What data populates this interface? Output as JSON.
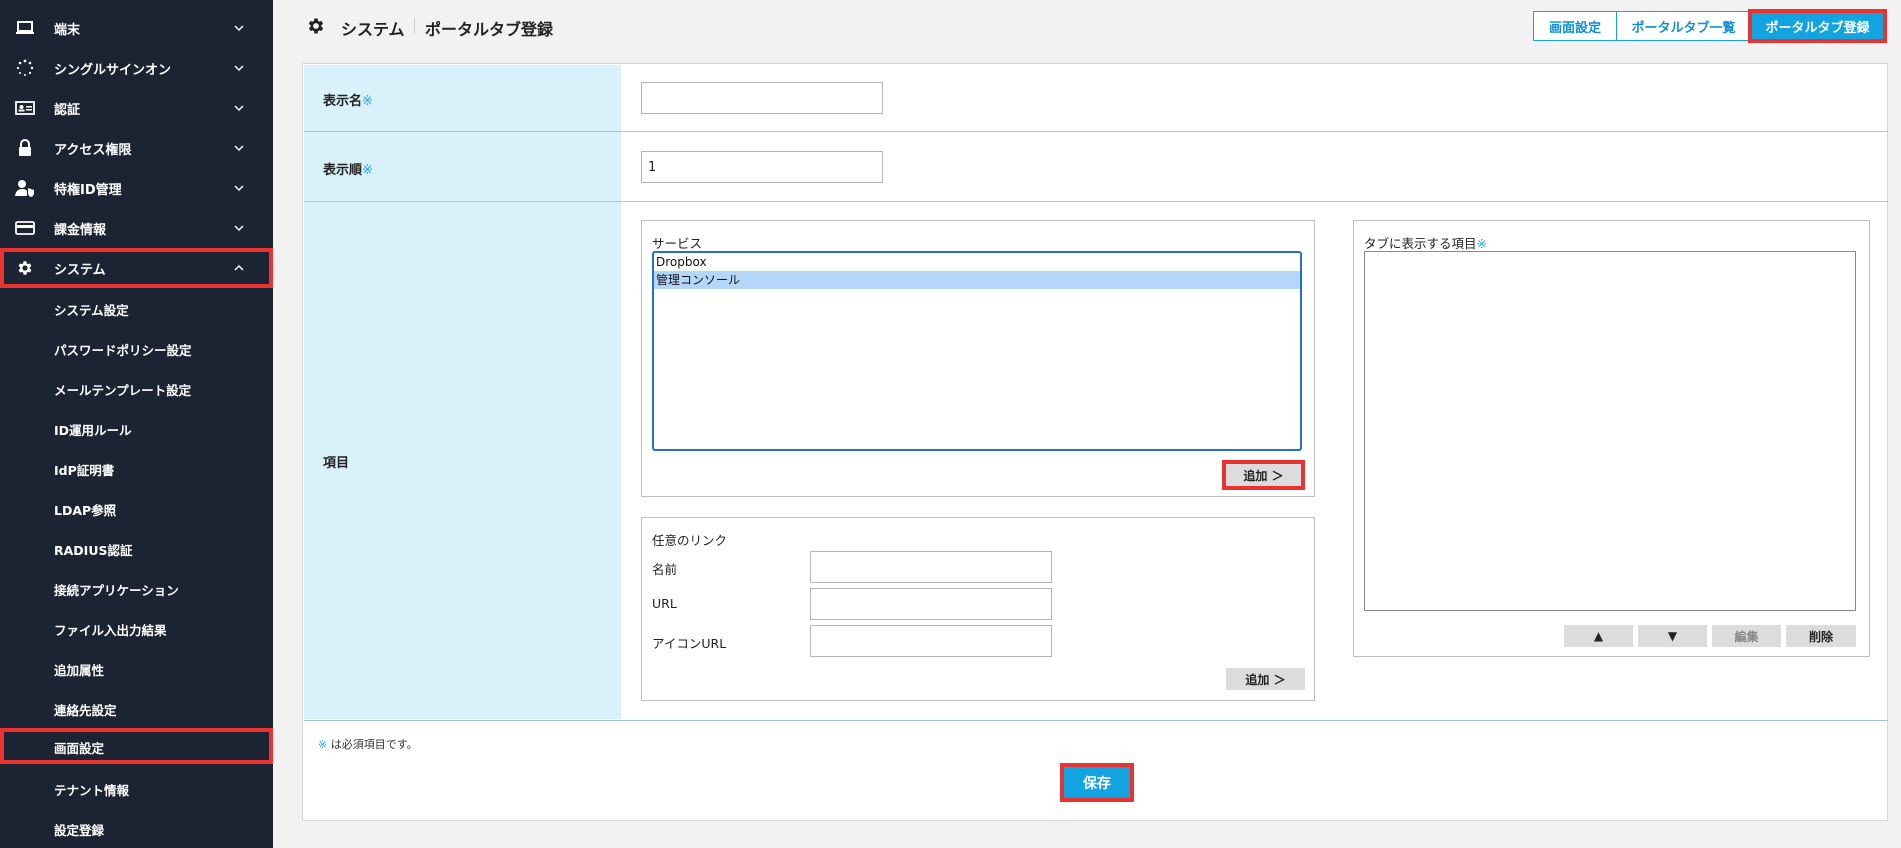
{
  "sidebar": {
    "items": [
      {
        "label": "端末",
        "icon": "laptop-icon",
        "expanded": false
      },
      {
        "label": "シングルサインオン",
        "icon": "dotted-circle-icon",
        "expanded": false
      },
      {
        "label": "認証",
        "icon": "id-card-icon",
        "expanded": false
      },
      {
        "label": "アクセス権限",
        "icon": "lock-icon",
        "expanded": false
      },
      {
        "label": "特権ID管理",
        "icon": "user-shield-icon",
        "expanded": false
      },
      {
        "label": "課金情報",
        "icon": "credit-card-icon",
        "expanded": false
      },
      {
        "label": "システム",
        "icon": "gear-icon",
        "expanded": true
      }
    ],
    "subitems": [
      {
        "label": "システム設定"
      },
      {
        "label": "パスワードポリシー設定"
      },
      {
        "label": "メールテンプレート設定"
      },
      {
        "label": "ID運用ルール"
      },
      {
        "label": "IdP証明書"
      },
      {
        "label": "LDAP参照"
      },
      {
        "label": "RADIUS認証"
      },
      {
        "label": "接続アプリケーション"
      },
      {
        "label": "ファイル入出力結果"
      },
      {
        "label": "追加属性"
      },
      {
        "label": "連絡先設定"
      },
      {
        "label": "画面設定",
        "active": true
      },
      {
        "label": "テナント情報"
      },
      {
        "label": "設定登録"
      }
    ]
  },
  "header": {
    "breadcrumb_section": "システム",
    "breadcrumb_page": "ポータルタブ登録",
    "buttons": {
      "screen_settings": "画面設定",
      "portal_tab_list": "ポータルタブ一覧",
      "portal_tab_register": "ポータルタブ登録"
    }
  },
  "form": {
    "required_mark": "※",
    "display_name": {
      "label": "表示名",
      "value": ""
    },
    "display_order": {
      "label": "表示順",
      "value": "1"
    },
    "items": {
      "label": "項目",
      "services": {
        "title": "サービス",
        "options": [
          "Dropbox",
          "管理コンソール"
        ],
        "selected": "管理コンソール",
        "add_button": "追加 ＞"
      },
      "custom_link": {
        "title": "任意のリンク",
        "name_label": "名前",
        "url_label": "URL",
        "icon_url_label": "アイコンURL",
        "name_value": "",
        "url_value": "",
        "icon_url_value": "",
        "add_button": "追加 ＞"
      },
      "tab_items": {
        "title": "タブに表示する項目",
        "up_button": "▲",
        "down_button": "▼",
        "edit_button": "編集",
        "delete_button": "削除"
      }
    },
    "note": "は必須項目です。",
    "save_button": "保存"
  },
  "colors": {
    "sidebar_bg": "#1c2433",
    "accent": "#12a3e0",
    "label_bg": "#d9f1fb",
    "highlight": "#e8332e"
  }
}
